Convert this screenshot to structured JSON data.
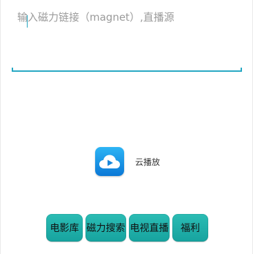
{
  "search": {
    "placeholder": "输入磁力链接（magnet）,直播源",
    "value": ""
  },
  "cloud_play": {
    "label": "云播放",
    "icon": "cloud-play-icon",
    "icon_color": "#1e96e8"
  },
  "nav": {
    "items": [
      {
        "label": "电影库"
      },
      {
        "label": "磁力搜索"
      },
      {
        "label": "电视直播"
      },
      {
        "label": "福利"
      }
    ],
    "color": "#1fb1ab"
  },
  "accent_color": "#22a6c2"
}
